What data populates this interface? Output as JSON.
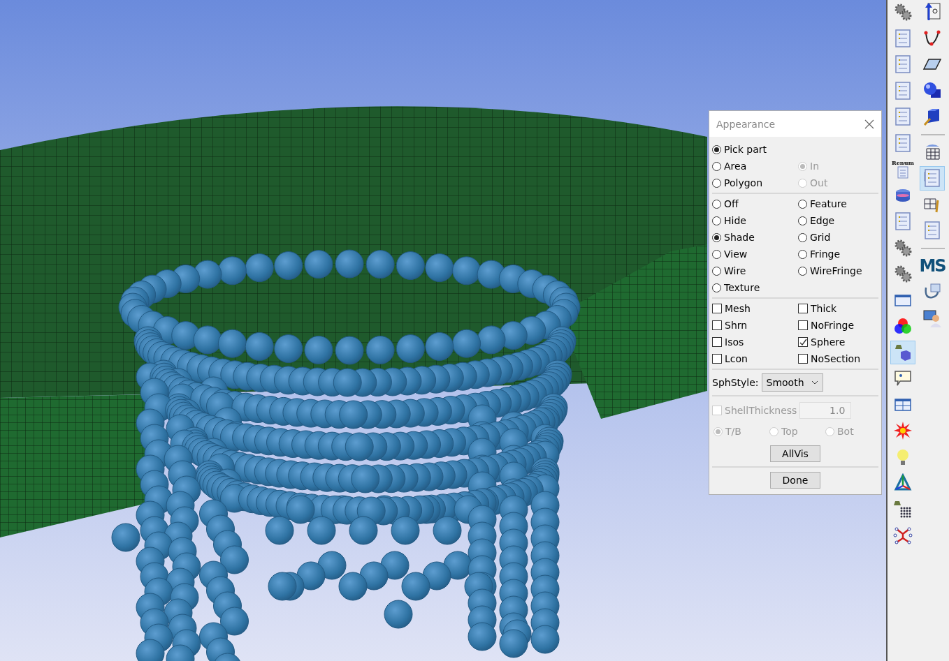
{
  "dialog": {
    "title": "Appearance",
    "pick_modes": [
      {
        "label": "Pick part",
        "selected": true
      },
      {
        "label": "Area",
        "selected": false
      },
      {
        "label": "Polygon",
        "selected": false
      }
    ],
    "area_modes": [
      {
        "label": "In",
        "selected": true,
        "disabled": true
      },
      {
        "label": "Out",
        "selected": false,
        "disabled": true
      }
    ],
    "display_modes": [
      {
        "label": "Off",
        "selected": false
      },
      {
        "label": "Hide",
        "selected": false
      },
      {
        "label": "Shade",
        "selected": true
      },
      {
        "label": "View",
        "selected": false
      },
      {
        "label": "Wire",
        "selected": false
      },
      {
        "label": "Texture",
        "selected": false
      }
    ],
    "overlay_modes": [
      {
        "label": "Feature",
        "selected": false
      },
      {
        "label": "Edge",
        "selected": false
      },
      {
        "label": "Grid",
        "selected": false
      },
      {
        "label": "Fringe",
        "selected": false
      },
      {
        "label": "WireFringe",
        "selected": false
      }
    ],
    "options_left": [
      {
        "label": "Mesh",
        "checked": false
      },
      {
        "label": "Shrn",
        "checked": false
      },
      {
        "label": "Isos",
        "checked": false
      },
      {
        "label": "Lcon",
        "checked": false
      }
    ],
    "options_right": [
      {
        "label": "Thick",
        "checked": false
      },
      {
        "label": "NoFringe",
        "checked": false
      },
      {
        "label": "Sphere",
        "checked": true
      },
      {
        "label": "NoSection",
        "checked": false
      }
    ],
    "sph_style": {
      "label": "SphStyle:",
      "value": "Smooth"
    },
    "shell_thickness": {
      "label": "ShellThickness",
      "checked": false,
      "disabled": true,
      "value": "1.0"
    },
    "shell_sides": [
      {
        "label": "T/B",
        "selected": true,
        "disabled": true
      },
      {
        "label": "Top",
        "selected": false,
        "disabled": true
      },
      {
        "label": "Bot",
        "selected": false,
        "disabled": true
      }
    ],
    "buttons": [
      "AllVis",
      "Done"
    ]
  },
  "toolbar": {
    "left": [
      {
        "kind": "tool",
        "selected": false
      },
      {
        "kind": "tool",
        "selected": false
      },
      {
        "kind": "tool",
        "selected": false
      },
      {
        "kind": "tool",
        "selected": false
      },
      {
        "kind": "tool",
        "selected": false
      },
      {
        "kind": "tool",
        "selected": false
      },
      {
        "kind": "text-tool",
        "label": "Renum",
        "selected": false
      },
      {
        "kind": "tool",
        "selected": false
      },
      {
        "kind": "tool",
        "selected": false
      },
      {
        "kind": "tool",
        "selected": false
      },
      {
        "kind": "tool",
        "selected": false
      },
      {
        "kind": "tool",
        "selected": false
      },
      {
        "kind": "tool",
        "selected": false
      },
      {
        "kind": "tool",
        "selected": true
      },
      {
        "kind": "tool",
        "selected": false
      },
      {
        "kind": "tool",
        "selected": false
      },
      {
        "kind": "tool",
        "selected": false
      },
      {
        "kind": "tool",
        "selected": false
      },
      {
        "kind": "tool",
        "selected": false
      },
      {
        "kind": "tool",
        "selected": false
      },
      {
        "kind": "tool",
        "selected": false
      }
    ],
    "right": [
      {
        "kind": "tool",
        "selected": false
      },
      {
        "kind": "tool",
        "selected": false
      },
      {
        "kind": "tool",
        "selected": false
      },
      {
        "kind": "tool",
        "selected": false
      },
      {
        "kind": "tool",
        "selected": false
      },
      {
        "kind": "separator"
      },
      {
        "kind": "tool",
        "selected": false
      },
      {
        "kind": "tool",
        "selected": true
      },
      {
        "kind": "tool",
        "selected": false
      },
      {
        "kind": "tool",
        "selected": false
      },
      {
        "kind": "separator"
      },
      {
        "kind": "logo",
        "label": "MS",
        "selected": false
      },
      {
        "kind": "tool",
        "selected": false
      },
      {
        "kind": "tool",
        "selected": false
      }
    ]
  }
}
